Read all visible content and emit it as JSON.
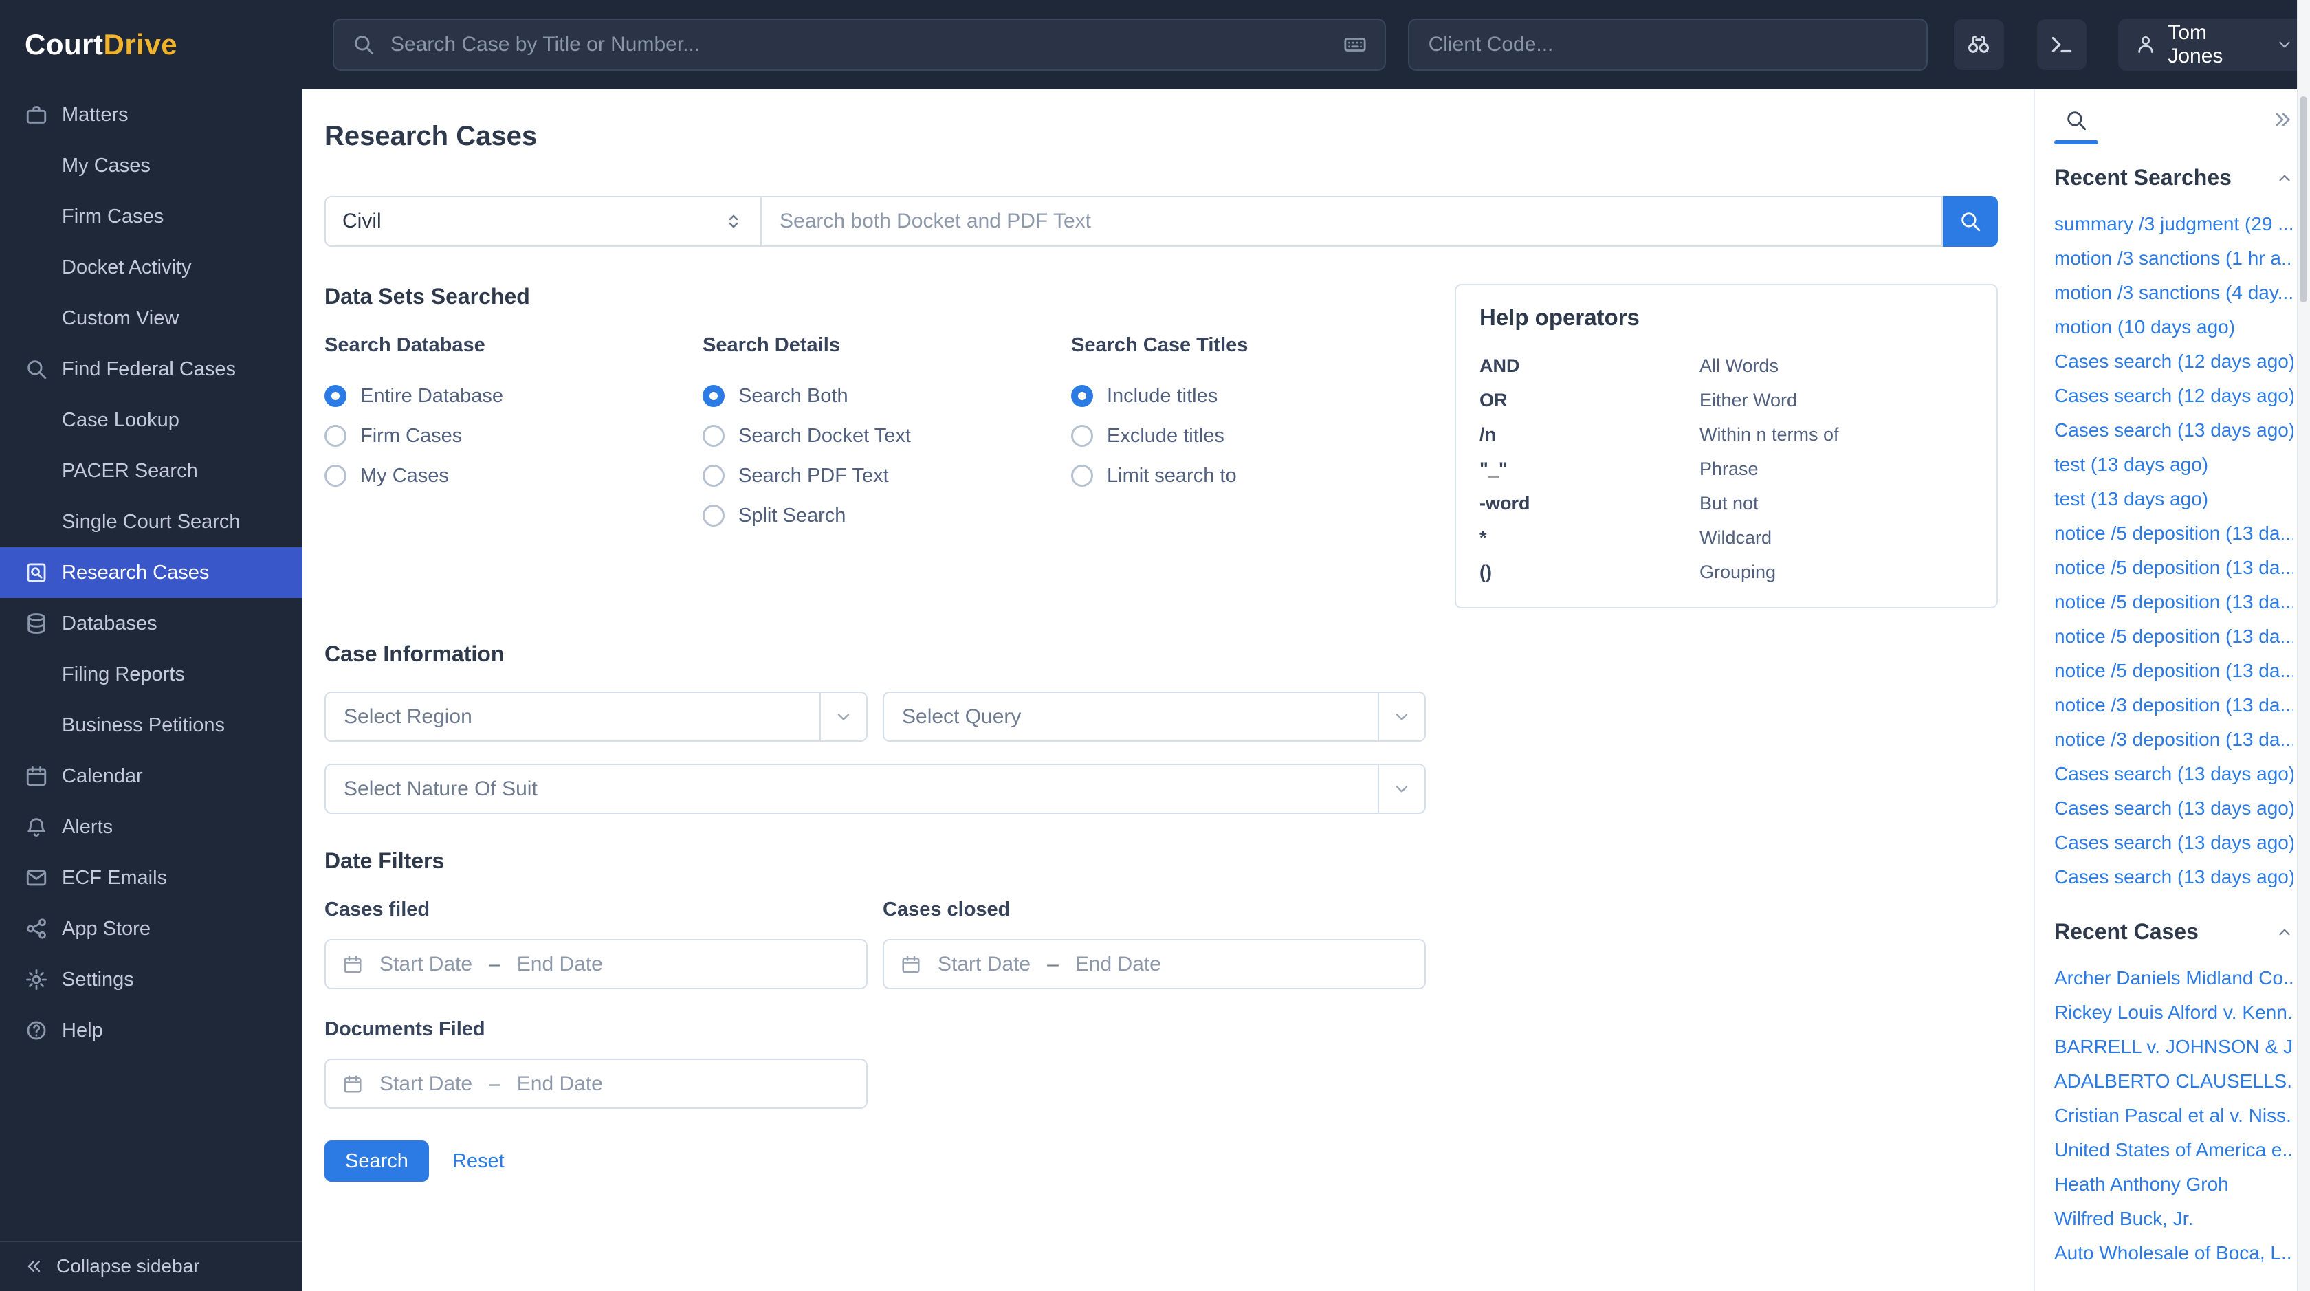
{
  "colors": {
    "primary": "#2c7be5",
    "brand_accent": "#f2b32c",
    "sidebar_active": "#3a57c9",
    "navy": "#1f2838"
  },
  "brand": {
    "name_part1": "Court",
    "name_part2": "Drive"
  },
  "header": {
    "case_search_placeholder": "Search Case by Title or Number...",
    "client_code_placeholder": "Client Code...",
    "user_name": "Tom Jones"
  },
  "sidebar": {
    "items": [
      {
        "label": "Matters",
        "icon": "briefcase-icon"
      },
      {
        "label": "My Cases",
        "indent": true
      },
      {
        "label": "Firm Cases",
        "indent": true
      },
      {
        "label": "Docket Activity",
        "indent": true
      },
      {
        "label": "Custom View",
        "indent": true
      },
      {
        "label": "Find Federal Cases",
        "icon": "magnifier-icon"
      },
      {
        "label": "Case Lookup",
        "indent": true
      },
      {
        "label": "PACER Search",
        "indent": true
      },
      {
        "label": "Single Court Search",
        "indent": true
      },
      {
        "label": "Research Cases",
        "icon": "file-search-icon",
        "active": true
      },
      {
        "label": "Databases",
        "icon": "database-icon"
      },
      {
        "label": "Filing Reports",
        "indent": true
      },
      {
        "label": "Business Petitions",
        "indent": true
      },
      {
        "label": "Calendar",
        "icon": "calendar-icon"
      },
      {
        "label": "Alerts",
        "icon": "bell-icon"
      },
      {
        "label": "ECF Emails",
        "icon": "envelope-icon"
      },
      {
        "label": "App Store",
        "icon": "share-nodes-icon"
      },
      {
        "label": "Settings",
        "icon": "gear-icon"
      },
      {
        "label": "Help",
        "icon": "circle-question-icon"
      }
    ],
    "collapse_label": "Collapse sidebar"
  },
  "main": {
    "title": "Research Cases",
    "search_bar": {
      "category": "Civil",
      "placeholder": "Search both Docket and PDF Text"
    },
    "data_sets": {
      "heading": "Data Sets Searched",
      "groups": [
        {
          "label": "Search Database",
          "options": [
            {
              "label": "Entire Database",
              "checked": true
            },
            {
              "label": "Firm Cases"
            },
            {
              "label": "My Cases"
            }
          ]
        },
        {
          "label": "Search Details",
          "options": [
            {
              "label": "Search Both",
              "checked": true
            },
            {
              "label": "Search Docket Text"
            },
            {
              "label": "Search PDF Text"
            },
            {
              "label": "Split Search"
            }
          ]
        },
        {
          "label": "Search Case Titles",
          "options": [
            {
              "label": "Include titles",
              "checked": true
            },
            {
              "label": "Exclude titles"
            },
            {
              "label": "Limit search to"
            }
          ]
        }
      ]
    },
    "help_operators": {
      "title": "Help operators",
      "rows": [
        {
          "op": "AND",
          "desc": "All Words"
        },
        {
          "op": "OR",
          "desc": "Either Word"
        },
        {
          "op": "/n",
          "desc": "Within n terms of"
        },
        {
          "op": "\"_\"",
          "desc": "Phrase"
        },
        {
          "op": "-word",
          "desc": "But not"
        },
        {
          "op": "*",
          "desc": "Wildcard"
        },
        {
          "op": "()",
          "desc": "Grouping"
        }
      ]
    },
    "case_information": {
      "heading": "Case Information",
      "region_placeholder": "Select Region",
      "query_placeholder": "Select Query",
      "nature_placeholder": "Select Nature Of Suit"
    },
    "date_filters": {
      "heading": "Date Filters",
      "cases_filed_label": "Cases filed",
      "cases_closed_label": "Cases closed",
      "documents_filed_label": "Documents Filed",
      "start_placeholder": "Start Date",
      "end_placeholder": "End Date",
      "dash": "–"
    },
    "actions": {
      "search": "Search",
      "reset": "Reset"
    }
  },
  "right_panel": {
    "recent_searches": {
      "title": "Recent Searches",
      "items": [
        "summary /3 judgment (29 ...",
        "motion /3 sanctions (1 hr a...",
        "motion /3 sanctions (4 day...",
        "motion (10 days ago)",
        "Cases search (12 days ago)",
        "Cases search (12 days ago)",
        "Cases search (13 days ago)",
        "test (13 days ago)",
        "test (13 days ago)",
        "notice /5 deposition (13 da...",
        "notice /5 deposition (13 da...",
        "notice /5 deposition (13 da...",
        "notice /5 deposition (13 da...",
        "notice /5 deposition (13 da...",
        "notice /3 deposition (13 da...",
        "notice /3 deposition (13 da...",
        "Cases search (13 days ago)",
        "Cases search (13 days ago)",
        "Cases search (13 days ago)",
        "Cases search (13 days ago)"
      ]
    },
    "recent_cases": {
      "title": "Recent Cases",
      "items": [
        "Archer Daniels Midland Co...",
        "Rickey Louis Alford v. Kenn...",
        "BARRELL v. JOHNSON & J...",
        "ADALBERTO CLAUSELLS...",
        "Cristian Pascal et al v. Niss...",
        "United States of America e...",
        "Heath Anthony Groh",
        "Wilfred Buck, Jr.",
        "Auto Wholesale of Boca, L..."
      ]
    }
  }
}
